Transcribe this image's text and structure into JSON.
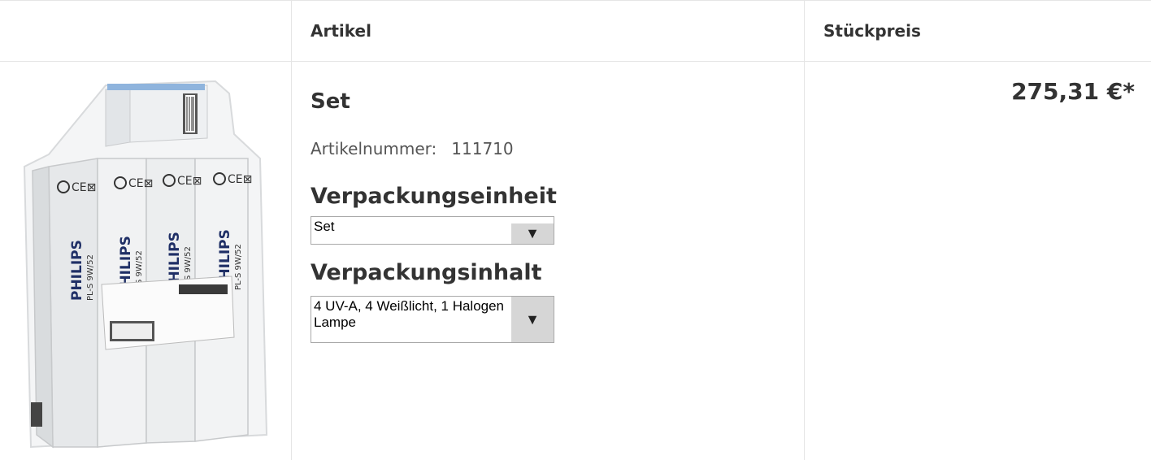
{
  "table": {
    "headers": {
      "image": "",
      "article": "Artikel",
      "unit_price": "Stückpreis"
    }
  },
  "product": {
    "image_icon": "product-photo-boxed-lamp-set",
    "name": "Set",
    "article_number_label": "Artikelnummer:",
    "article_number": "111710",
    "packaging_unit_label": "Verpackungseinheit",
    "packaging_unit_value": "Set",
    "packaging_content_label": "Verpackungsinhalt",
    "packaging_content_value": "4 UV-A, 4 Weißlicht, 1 Halogen Lampe",
    "price": "275,31 €*"
  },
  "colors": {
    "text": "#333333",
    "border": "#e5e5e5",
    "select_arrow_bg": "#d6d6d6"
  },
  "icons": {
    "dropdown": "triangle-down-icon"
  }
}
